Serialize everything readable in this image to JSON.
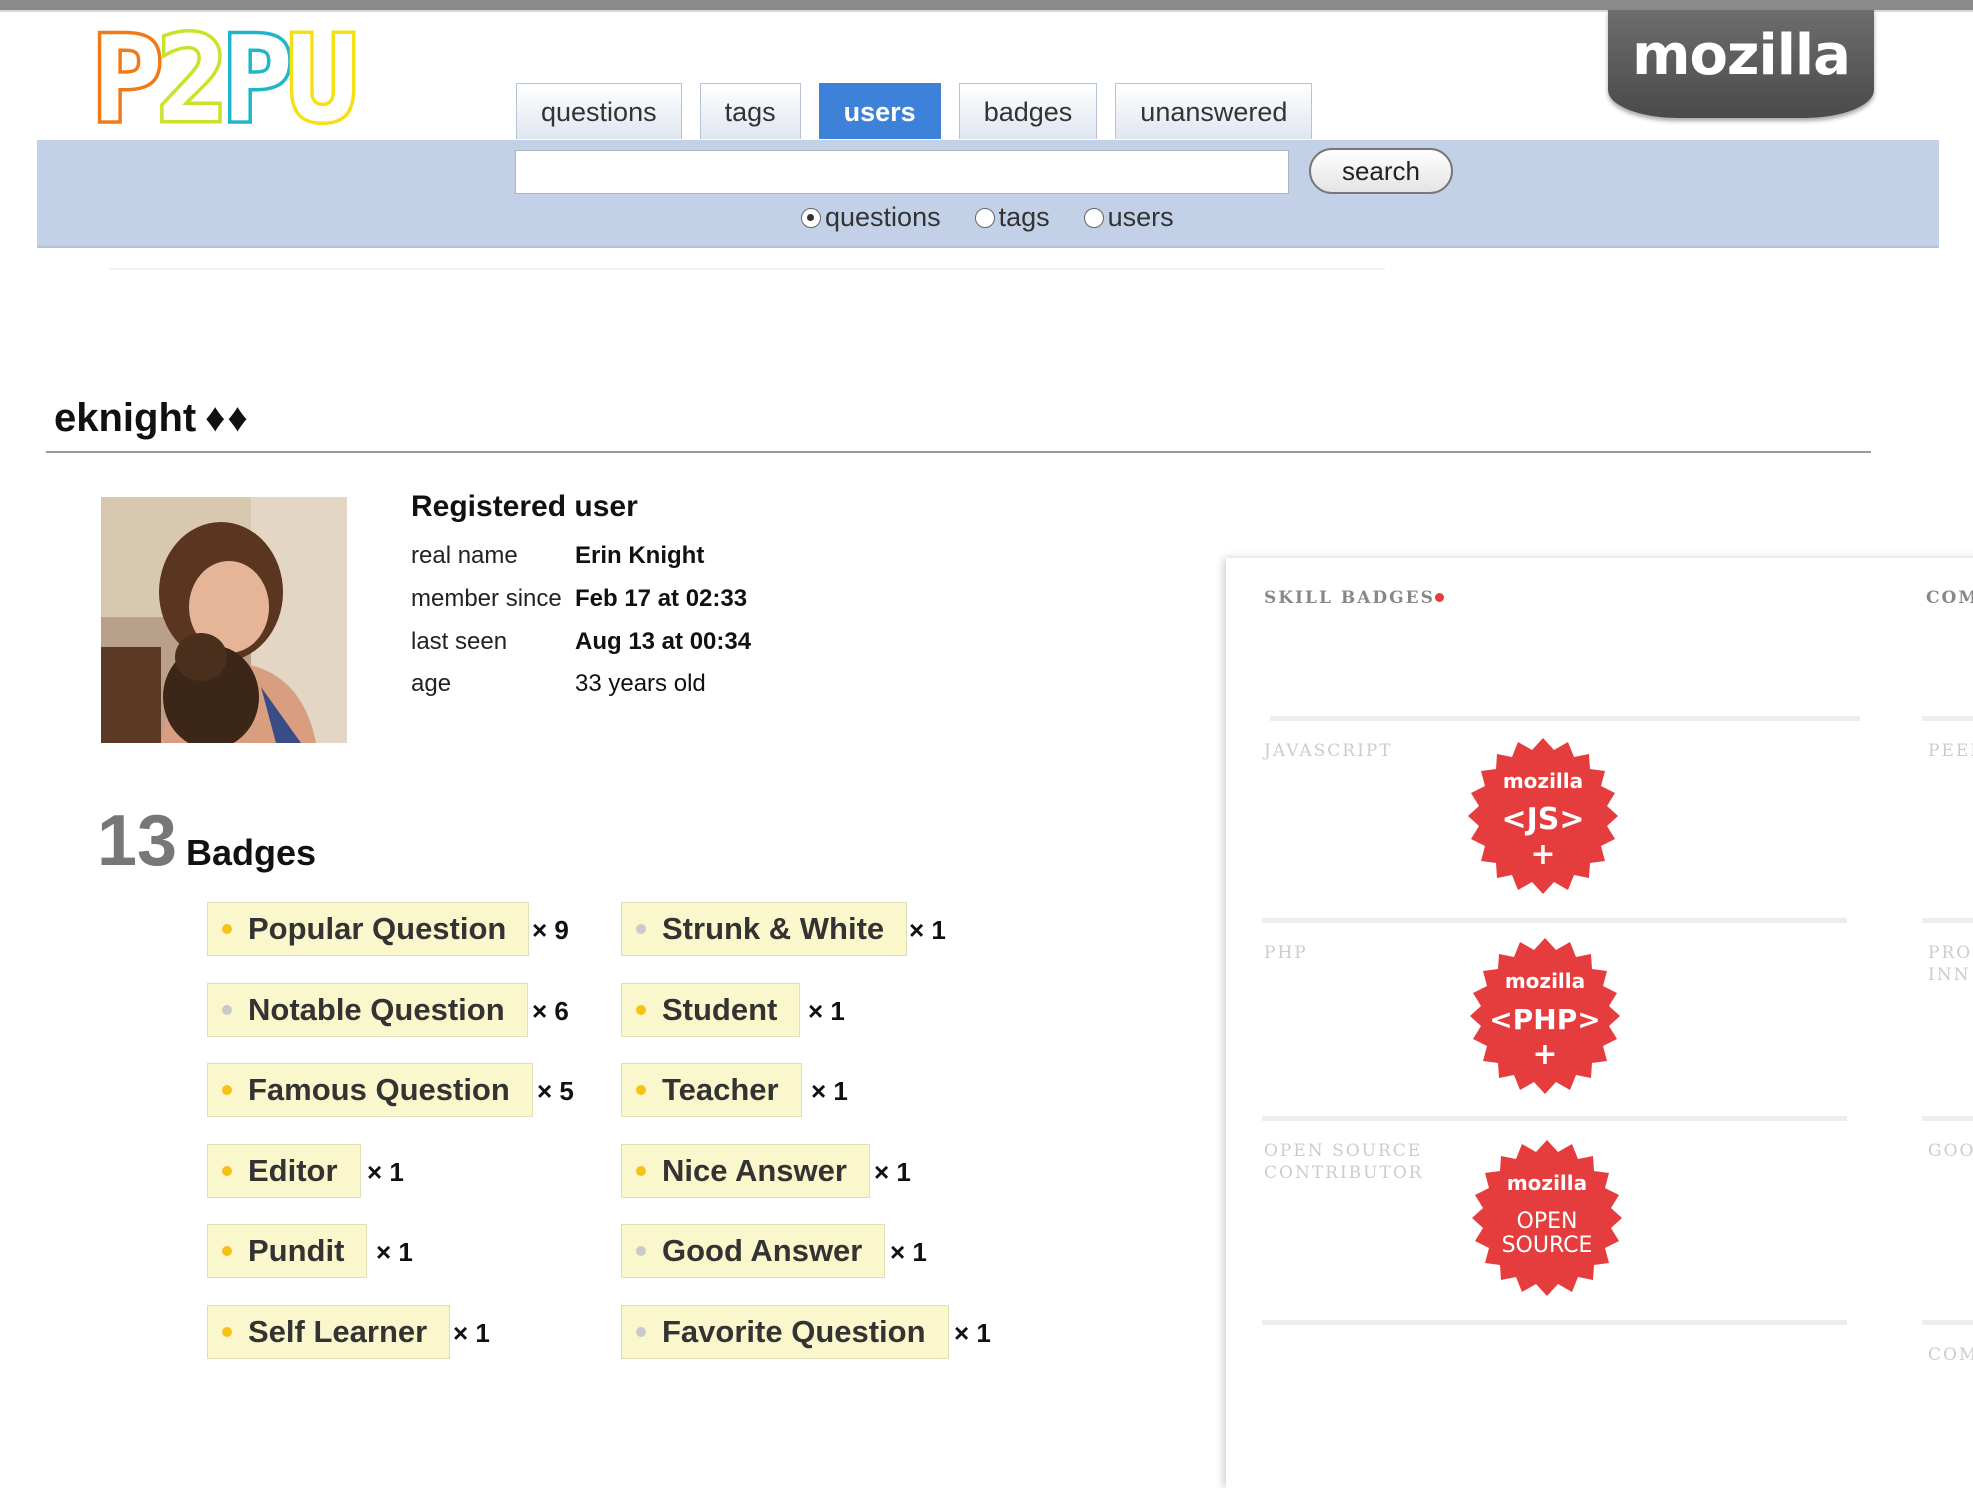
{
  "logo": {
    "text": "P2PU"
  },
  "brand_tab": {
    "label": "mozilla"
  },
  "nav": {
    "tabs": [
      {
        "label": "questions"
      },
      {
        "label": "tags"
      },
      {
        "label": "users",
        "active": true
      },
      {
        "label": "badges"
      },
      {
        "label": "unanswered"
      }
    ]
  },
  "search": {
    "value": "",
    "button_label": "search",
    "scopes": [
      {
        "label": "questions",
        "selected": true
      },
      {
        "label": "tags",
        "selected": false
      },
      {
        "label": "users",
        "selected": false
      }
    ]
  },
  "user": {
    "name": "eknight",
    "diamonds": "♦♦",
    "status": "Registered user",
    "fields": [
      {
        "key": "real name",
        "value": "Erin Knight"
      },
      {
        "key": "member since",
        "value": "Feb 17 at 02:33"
      },
      {
        "key": "last seen",
        "value": "Aug 13 at 00:34"
      },
      {
        "key": "age",
        "value": "33 years old"
      }
    ]
  },
  "badges": {
    "count": "13",
    "label": "Badges",
    "left": [
      {
        "name": "Popular Question",
        "mult": "× 9",
        "tier": "gold"
      },
      {
        "name": "Notable Question",
        "mult": "× 6",
        "tier": "silver"
      },
      {
        "name": "Famous Question",
        "mult": "× 5",
        "tier": "gold"
      },
      {
        "name": "Editor",
        "mult": "× 1",
        "tier": "gold"
      },
      {
        "name": "Pundit",
        "mult": "× 1",
        "tier": "gold"
      },
      {
        "name": "Self Learner",
        "mult": "× 1",
        "tier": "gold"
      }
    ],
    "right": [
      {
        "name": "Strunk & White",
        "mult": "× 1",
        "tier": "silver"
      },
      {
        "name": "Student",
        "mult": "× 1",
        "tier": "gold"
      },
      {
        "name": "Teacher",
        "mult": "× 1",
        "tier": "gold"
      },
      {
        "name": "Nice Answer",
        "mult": "× 1",
        "tier": "gold"
      },
      {
        "name": "Good Answer",
        "mult": "× 1",
        "tier": "silver"
      },
      {
        "name": "Favorite Question",
        "mult": "× 1",
        "tier": "silver"
      }
    ]
  },
  "skill_panel": {
    "heading": "SKILL BADGES",
    "heading2": "COM",
    "rows": [
      {
        "label": "JAVASCRIPT",
        "seal_top": "mozilla",
        "seal_main": "<JS>",
        "seal_sub": "+",
        "right_label": "PEEI"
      },
      {
        "label": "PHP",
        "seal_top": "mozilla",
        "seal_main": "<PHP>",
        "seal_sub": "+",
        "right_label": "PRO INN"
      },
      {
        "label": "OPEN SOURCE CONTRIBUTOR",
        "seal_top": "mozilla",
        "seal_main": "OPEN",
        "seal_sub": "SOURCE",
        "right_label": "GOO"
      }
    ],
    "footer_right_label": "COM",
    "seal_color": "#e53d3d"
  }
}
